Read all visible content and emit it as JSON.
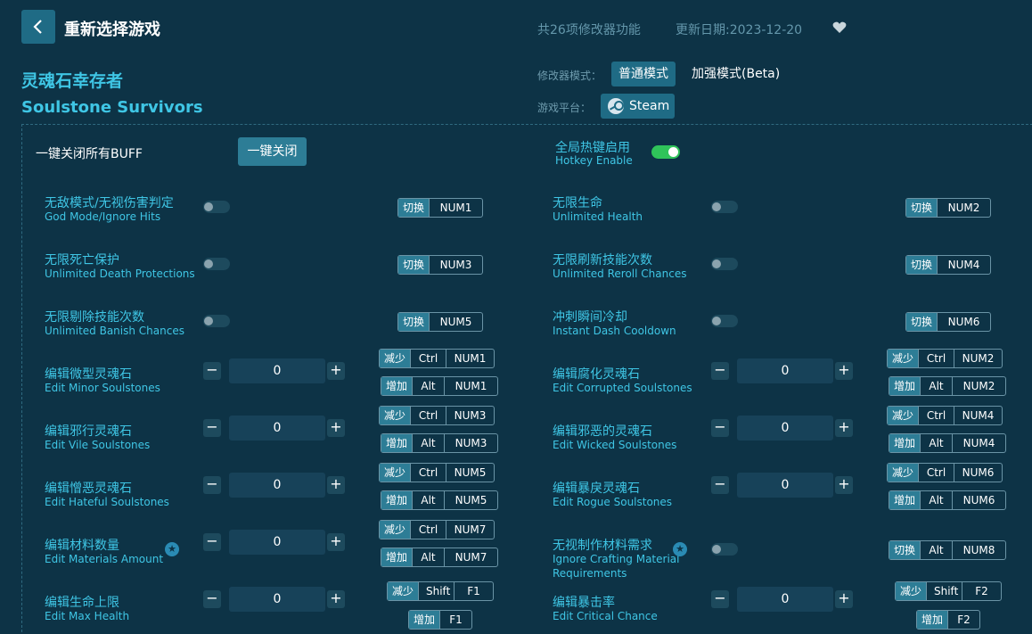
{
  "header": {
    "title": "重新选择游戏",
    "feature_count": "共26项修改器功能",
    "update_date": "更新日期:2023-12-20"
  },
  "game": {
    "name_cn": "灵魂石幸存者",
    "name_en": "Soulstone Survivors"
  },
  "mode": {
    "label": "修改器模式：",
    "normal": "普通模式",
    "enhanced": "加强模式(Beta)",
    "platform_label": "游戏平台：",
    "platform": "Steam"
  },
  "global": {
    "all_off_label": "一键关闭所有BUFF",
    "all_off_button": "一键关闭",
    "hotkey_cn": "全局热键启用",
    "hotkey_en": "Hotkey Enable"
  },
  "labels": {
    "toggle": "切换",
    "dec": "减少",
    "inc": "增加"
  },
  "features": [
    {
      "cn": "无敌模式/无视伤害判定",
      "en": "God Mode/Ignore Hits",
      "type": "toggle",
      "keys": [
        [
          "切换",
          "NUM1"
        ]
      ]
    },
    {
      "cn": "无限生命",
      "en": "Unlimited Health",
      "type": "toggle",
      "keys": [
        [
          "切换",
          "NUM2"
        ]
      ]
    },
    {
      "cn": "无限死亡保护",
      "en": "Unlimited Death Protections",
      "type": "toggle",
      "keys": [
        [
          "切换",
          "NUM3"
        ]
      ]
    },
    {
      "cn": "无限刷新技能次数",
      "en": "Unlimited Reroll Chances",
      "type": "toggle",
      "keys": [
        [
          "切换",
          "NUM4"
        ]
      ]
    },
    {
      "cn": "无限剔除技能次数",
      "en": "Unlimited Banish Chances",
      "type": "toggle",
      "keys": [
        [
          "切换",
          "NUM5"
        ]
      ]
    },
    {
      "cn": "冲刺瞬间冷却",
      "en": "Instant Dash Cooldown",
      "type": "toggle",
      "keys": [
        [
          "切换",
          "NUM6"
        ]
      ]
    },
    {
      "cn": "编辑微型灵魂石",
      "en": "Edit Minor Soulstones",
      "type": "number",
      "value": "0",
      "keys": [
        [
          "减少",
          "Ctrl",
          "NUM1"
        ],
        [
          "增加",
          "Alt",
          "NUM1"
        ]
      ]
    },
    {
      "cn": "编辑腐化灵魂石",
      "en": "Edit Corrupted Soulstones",
      "type": "number",
      "value": "0",
      "keys": [
        [
          "减少",
          "Ctrl",
          "NUM2"
        ],
        [
          "增加",
          "Alt",
          "NUM2"
        ]
      ]
    },
    {
      "cn": "编辑邪行灵魂石",
      "en": "Edit Vile Soulstones",
      "type": "number",
      "value": "0",
      "keys": [
        [
          "减少",
          "Ctrl",
          "NUM3"
        ],
        [
          "增加",
          "Alt",
          "NUM3"
        ]
      ]
    },
    {
      "cn": "编辑邪恶的灵魂石",
      "en": "Edit Wicked Soulstones",
      "type": "number",
      "value": "0",
      "keys": [
        [
          "减少",
          "Ctrl",
          "NUM4"
        ],
        [
          "增加",
          "Alt",
          "NUM4"
        ]
      ]
    },
    {
      "cn": "编辑憎恶灵魂石",
      "en": "Edit Hateful Soulstones",
      "type": "number",
      "value": "0",
      "keys": [
        [
          "减少",
          "Ctrl",
          "NUM5"
        ],
        [
          "增加",
          "Alt",
          "NUM5"
        ]
      ]
    },
    {
      "cn": "编辑暴戾灵魂石",
      "en": "Edit Rogue Soulstones",
      "type": "number",
      "value": "0",
      "keys": [
        [
          "减少",
          "Ctrl",
          "NUM6"
        ],
        [
          "增加",
          "Alt",
          "NUM6"
        ]
      ]
    },
    {
      "cn": "编辑材料数量",
      "en": "Edit Materials Amount",
      "type": "number",
      "star": true,
      "value": "0",
      "keys": [
        [
          "减少",
          "Ctrl",
          "NUM7"
        ],
        [
          "增加",
          "Alt",
          "NUM7"
        ]
      ]
    },
    {
      "cn": "无视制作材料需求",
      "en": "Ignore Crafting Material",
      "en2": "Requirements",
      "type": "toggle",
      "star": true,
      "keys": [
        [
          "切换",
          "Alt",
          "NUM8"
        ]
      ]
    },
    {
      "cn": "编辑生命上限",
      "en": "Edit Max Health",
      "type": "number",
      "value": "0",
      "keys": [
        [
          "减少",
          "Shift",
          "F1"
        ],
        [
          "增加",
          "F1"
        ]
      ]
    },
    {
      "cn": "编辑暴击率",
      "en": "Edit Critical Chance",
      "type": "number",
      "value": "0",
      "keys": [
        [
          "减少",
          "Shift",
          "F2"
        ],
        [
          "增加",
          "F2"
        ]
      ]
    }
  ],
  "colors": {
    "bg": "#0d3346",
    "accent": "#3fc6e5",
    "button": "#1f6b85",
    "toggle_on": "#2fc45a"
  }
}
